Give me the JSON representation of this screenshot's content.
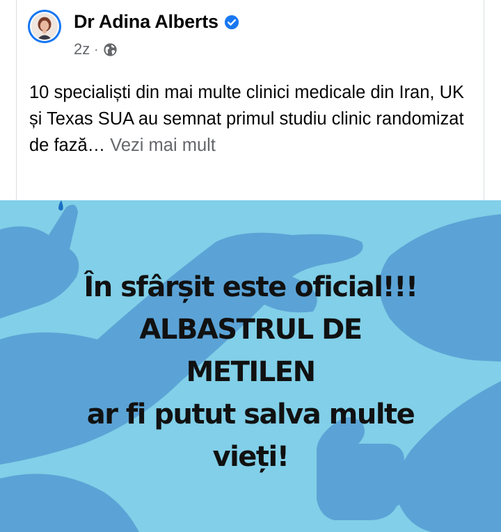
{
  "post": {
    "author": "Dr Adina Alberts",
    "verified_icon": "verified-badge-icon",
    "time": "2z",
    "separator": "·",
    "audience_icon": "globe-icon",
    "text": "10 specialiști din mai multe clinici medicale din Iran, UK și Texas SUA au semnat primul studiu clinic randomizat de fază…",
    "see_more": "Vezi mai mult"
  },
  "image": {
    "lines": [
      "În sfârșit este oficial!!!",
      "ALBASTRUL DE",
      "METILEN",
      "ar fi putut salva multe",
      "vieți!"
    ]
  },
  "colors": {
    "accent": "#1877f2",
    "image_bg": "#81cfe8",
    "hand_shapes": "#5ba3d6",
    "text_secondary": "#65676b"
  }
}
